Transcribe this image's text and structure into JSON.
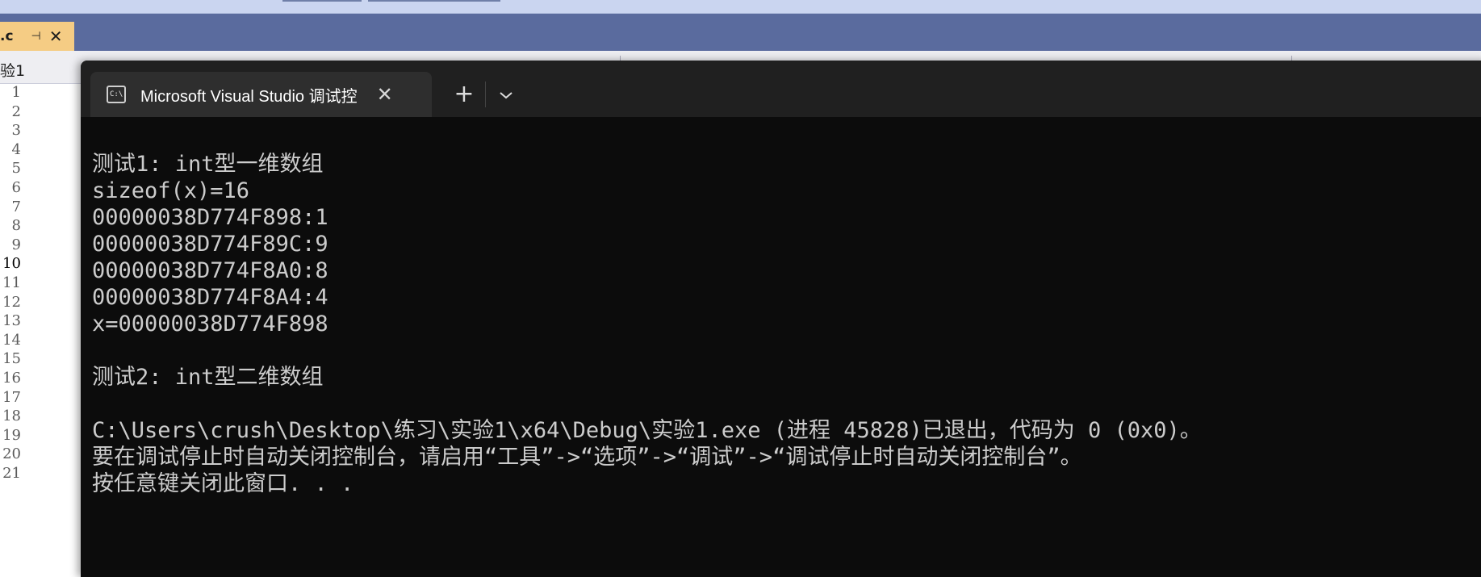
{
  "editor": {
    "file_tab": {
      "label": ".c",
      "pin_icon": "pin-icon",
      "close_icon": "close-icon"
    },
    "project_label": "验1",
    "current_line": "10",
    "line_numbers": [
      "1",
      "2",
      "3",
      "4",
      "5",
      "6",
      "7",
      "8",
      "9",
      "10",
      "11",
      "12",
      "13",
      "14",
      "15",
      "16",
      "17",
      "18",
      "19",
      "20",
      "21"
    ]
  },
  "terminal": {
    "tab_title": "Microsoft Visual Studio 调试控",
    "tab_icon": "console-icon",
    "icon_glyph": "C:\\",
    "new_tab_label": "+",
    "dropdown_label": "⌄",
    "output_lines": [
      "测试1: int型一维数组",
      "sizeof(x)=16",
      "00000038D774F898:1",
      "00000038D774F89C:9",
      "00000038D774F8A0:8",
      "00000038D774F8A4:4",
      "x=00000038D774F898",
      "",
      "测试2: int型二维数组",
      "",
      "C:\\Users\\crush\\Desktop\\练习\\实验1\\x64\\Debug\\实验1.exe (进程 45828)已退出，代码为 0 (0x0)。",
      "要在调试停止时自动关闭控制台，请启用“工具”->“选项”->“调试”->“调试停止时自动关闭控制台”。",
      "按任意键关闭此窗口. . ."
    ]
  },
  "colors": {
    "vs_tab_active": "#f5cc84",
    "vs_tabstrip": "#5a6b9e",
    "terminal_bg": "#0c0c0c",
    "terminal_text": "#cccccc"
  }
}
